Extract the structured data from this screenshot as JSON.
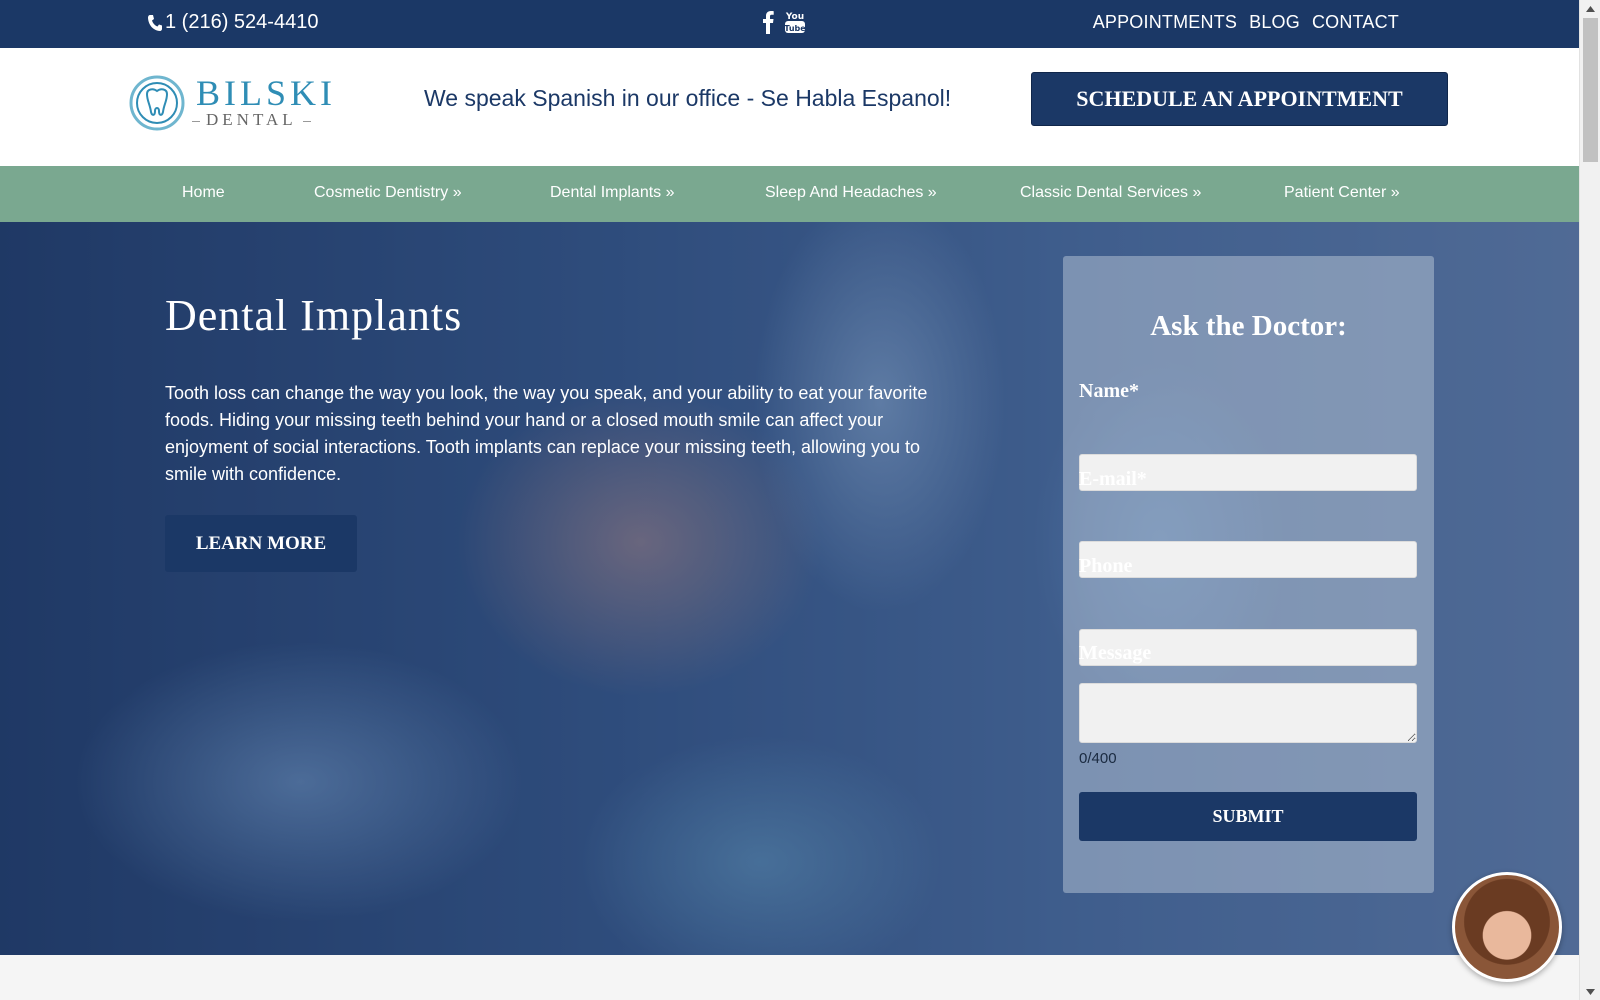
{
  "topbar": {
    "phone": "1 (216) 524-4410",
    "links": [
      "APPOINTMENTS",
      "BLOG",
      "CONTACT"
    ],
    "social_icons": [
      "facebook-icon",
      "youtube-icon"
    ]
  },
  "header": {
    "logo_main": "BILSKI",
    "logo_sub": "DENTAL",
    "tagline": "We speak Spanish in our office - Se Habla Espanol!",
    "cta": "SCHEDULE AN APPOINTMENT"
  },
  "nav": {
    "items": [
      "Home",
      "Cosmetic Dentistry »",
      "Dental Implants »",
      "Sleep And Headaches »",
      "Classic Dental Services »",
      "Patient Center »"
    ]
  },
  "hero": {
    "title": "Dental Implants",
    "text": "Tooth loss can change the way you look, the way you speak, and your ability to eat your favorite foods. Hiding your missing teeth behind your hand or a closed mouth smile can affect your enjoyment of social interactions. Tooth implants can replace your missing teeth, allowing you to smile with confidence.",
    "button": "LEARN MORE"
  },
  "form": {
    "title": "Ask the Doctor:",
    "fields": {
      "name_label": "Name*",
      "name_value": "",
      "email_label": "E-mail*",
      "email_value": "",
      "phone_label": "Phone",
      "phone_value": "",
      "message_label": "Message",
      "message_value": ""
    },
    "char_count": "0/400",
    "submit": "SUBMIT"
  },
  "colors": {
    "brand_navy": "#1b3866",
    "nav_green": "#7aa890",
    "logo_teal": "#2f8db5"
  }
}
